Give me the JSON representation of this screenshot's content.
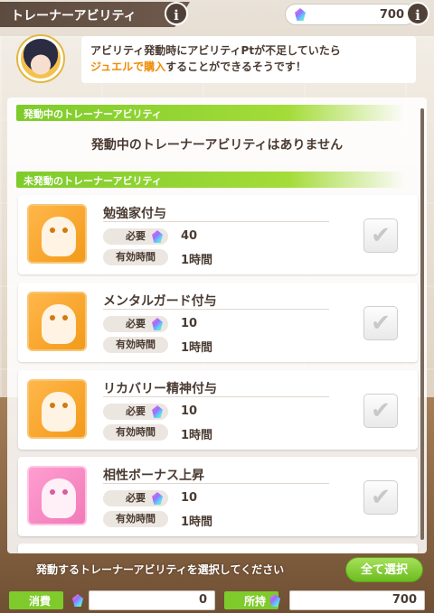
{
  "header": {
    "title": "トレーナーアビリティ",
    "jewel_count": "700",
    "info_label": "i"
  },
  "hint": {
    "line1": "アビリティ発動時にアビリティPtが不足していたら",
    "line2_highlight": "ジュエルで購入",
    "line2_rest": "することができるそうです！"
  },
  "sections": {
    "active_title": "発動中のトレーナーアビリティ",
    "active_empty": "発動中のトレーナーアビリティはありません",
    "inactive_title": "未発動のトレーナーアビリティ"
  },
  "labels": {
    "cost": "必要",
    "duration": "有効時間"
  },
  "abilities": [
    {
      "name": "勉強家付与",
      "cost": "40",
      "duration": "1時間"
    },
    {
      "name": "メンタルガード付与",
      "cost": "10",
      "duration": "1時間"
    },
    {
      "name": "リカバリー精神付与",
      "cost": "10",
      "duration": "1時間"
    },
    {
      "name": "相性ボーナス上昇",
      "cost": "10",
      "duration": "1時間"
    }
  ],
  "footer": {
    "instruction": "発動するトレーナーアビリティを選択してください",
    "select_all": "全て選択",
    "consume_label": "消費",
    "consume_value": "0",
    "owned_label": "所持",
    "owned_value": "700"
  },
  "icons": {
    "check": "✔",
    "jewel": "jewel-icon"
  }
}
